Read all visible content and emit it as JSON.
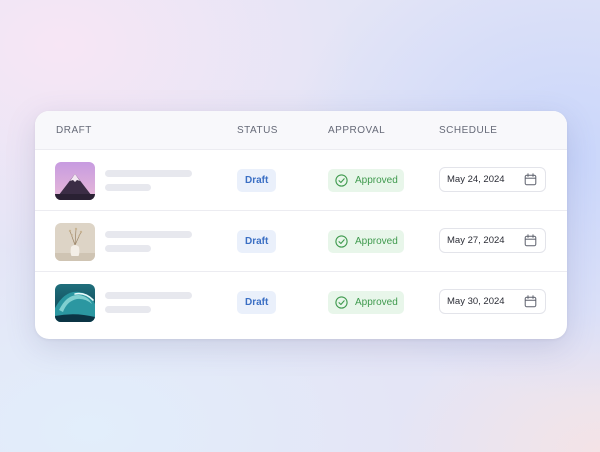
{
  "table": {
    "columns": {
      "draft": "DRAFT",
      "status": "STATUS",
      "approval": "APPROVAL",
      "schedule": "SCHEDULE"
    },
    "rows": [
      {
        "thumbnail": "mountain-peak-image",
        "status": "Draft",
        "approval": "Approved",
        "schedule": "May 24, 2024"
      },
      {
        "thumbnail": "vase-with-dried-flowers-image",
        "status": "Draft",
        "approval": "Approved",
        "schedule": "May 27, 2024"
      },
      {
        "thumbnail": "ocean-wave-image",
        "status": "Draft",
        "approval": "Approved",
        "schedule": "May 30, 2024"
      }
    ]
  },
  "colors": {
    "draft_badge_bg": "#eaf0fb",
    "draft_badge_text": "#3b6fc4",
    "approved_badge_bg": "#e8f6ea",
    "approved_badge_text": "#3f9a4e"
  },
  "icons": {
    "approval": "check-circle-icon",
    "schedule": "calendar-icon"
  }
}
